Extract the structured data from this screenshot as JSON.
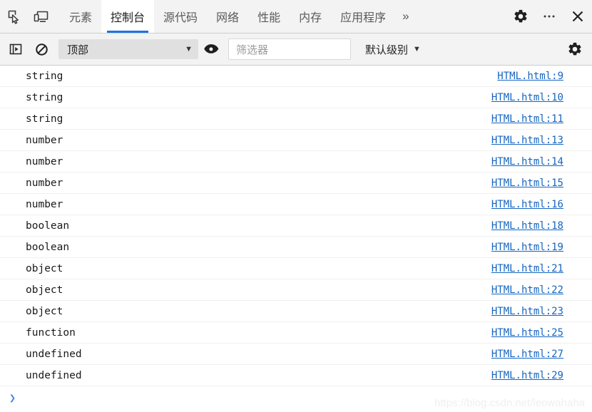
{
  "tabbar": {
    "inspect_icon": "inspect-cursor-icon",
    "device_icon": "device-toolbar-icon",
    "tabs": [
      {
        "label": "元素",
        "active": false
      },
      {
        "label": "控制台",
        "active": true
      },
      {
        "label": "源代码",
        "active": false
      },
      {
        "label": "网络",
        "active": false
      },
      {
        "label": "性能",
        "active": false
      },
      {
        "label": "内存",
        "active": false
      },
      {
        "label": "应用程序",
        "active": false
      }
    ],
    "more_tabs_label": "»",
    "settings_icon": "gear-icon",
    "menu_icon": "more-options-icon",
    "close_icon": "close-icon"
  },
  "toolbar": {
    "sidebar_toggle_icon": "console-sidebar-icon",
    "clear_icon": "clear-console-icon",
    "context_value": "顶部",
    "context_caret": "▼",
    "eye_icon": "live-expression-eye-icon",
    "filter_placeholder": "筛选器",
    "filter_value": "",
    "level_value": "默认级别",
    "level_caret": "▼",
    "settings_icon": "console-settings-gear-icon"
  },
  "console": {
    "rows": [
      {
        "message": "string",
        "source": "HTML.html:9"
      },
      {
        "message": "string",
        "source": "HTML.html:10"
      },
      {
        "message": "string",
        "source": "HTML.html:11"
      },
      {
        "message": "number",
        "source": "HTML.html:13"
      },
      {
        "message": "number",
        "source": "HTML.html:14"
      },
      {
        "message": "number",
        "source": "HTML.html:15"
      },
      {
        "message": "number",
        "source": "HTML.html:16"
      },
      {
        "message": "boolean",
        "source": "HTML.html:18"
      },
      {
        "message": "boolean",
        "source": "HTML.html:19"
      },
      {
        "message": "object",
        "source": "HTML.html:21"
      },
      {
        "message": "object",
        "source": "HTML.html:22"
      },
      {
        "message": "object",
        "source": "HTML.html:23"
      },
      {
        "message": "function",
        "source": "HTML.html:25"
      },
      {
        "message": "undefined",
        "source": "HTML.html:27"
      },
      {
        "message": "undefined",
        "source": "HTML.html:29"
      }
    ],
    "prompt_caret": "❯",
    "prompt_value": ""
  },
  "watermark": {
    "text": "https://blog.csdn.net/leowahaha"
  },
  "colors": {
    "accent_blue": "#1a73e8",
    "link_blue": "#1565c0",
    "prompt_blue": "#4285f4",
    "toolbar_bg": "#f3f3f3",
    "row_divider": "#f0f0f0"
  }
}
